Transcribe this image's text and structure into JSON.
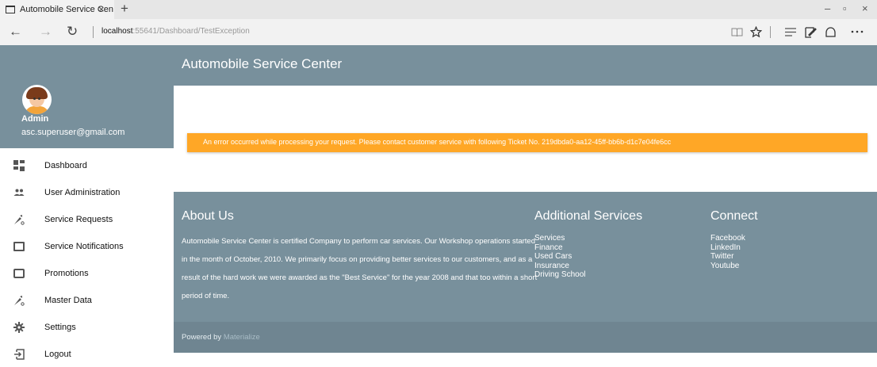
{
  "browser": {
    "tab_title": "Automobile Service Cen",
    "tab_close": "×",
    "new_tab": "+",
    "url_host": "localhost",
    "url_path": ":55641/Dashboard/TestException",
    "back": "←",
    "forward": "→",
    "refresh": "↻",
    "window_minimize": "–",
    "window_restore": "▫",
    "window_close": "×"
  },
  "icons": {
    "tab_page": "page-icon",
    "reading_view": "book-icon",
    "favorite": "star-icon",
    "hub": "hub-icon",
    "notes": "pen-icon",
    "share": "share-icon",
    "more": "more-icon",
    "dashboard": "dashboard-icon",
    "user_admin": "people-icon",
    "service_requests": "wrench-icon",
    "service_notifications": "message-icon",
    "promotions": "box-icon",
    "master_data": "wrench-icon",
    "settings": "gear-icon",
    "logout": "logout-icon"
  },
  "profile": {
    "name": "Admin",
    "email": "asc.superuser@gmail.com"
  },
  "menu": [
    {
      "label": "Dashboard"
    },
    {
      "label": "User Administration"
    },
    {
      "label": "Service Requests"
    },
    {
      "label": "Service Notifications"
    },
    {
      "label": "Promotions"
    },
    {
      "label": "Master Data"
    },
    {
      "label": "Settings"
    },
    {
      "label": "Logout"
    }
  ],
  "header": {
    "title": "Automobile Service Center"
  },
  "alert": {
    "message": "An error occurred while processing your request. Please contact customer service with following Ticket No. 219dbda0-aa12-45ff-bb6b-d1c7e04fe6cc"
  },
  "footer": {
    "about_title": "About Us",
    "about_text": "Automobile Service Center is certified Company to perform car services. Our Workshop operations started in the month of October, 2010. We primarily focus on providing better services to our customers, and as a result of the hard work we were awarded as the \"Best Service\" for the year 2008 and that too within a short period of time.",
    "services_title": "Additional Services",
    "services": [
      "Services",
      "Finance",
      "Used Cars",
      "Insurance",
      "Driving School"
    ],
    "connect_title": "Connect",
    "connect": [
      "Facebook",
      "LinkedIn",
      "Twitter",
      "Youtube"
    ],
    "powered_by": "Powered by",
    "powered_link": "Materialize"
  },
  "colors": {
    "primary": "#78909c",
    "alert": "#ffa726",
    "background": "#ffffff"
  }
}
